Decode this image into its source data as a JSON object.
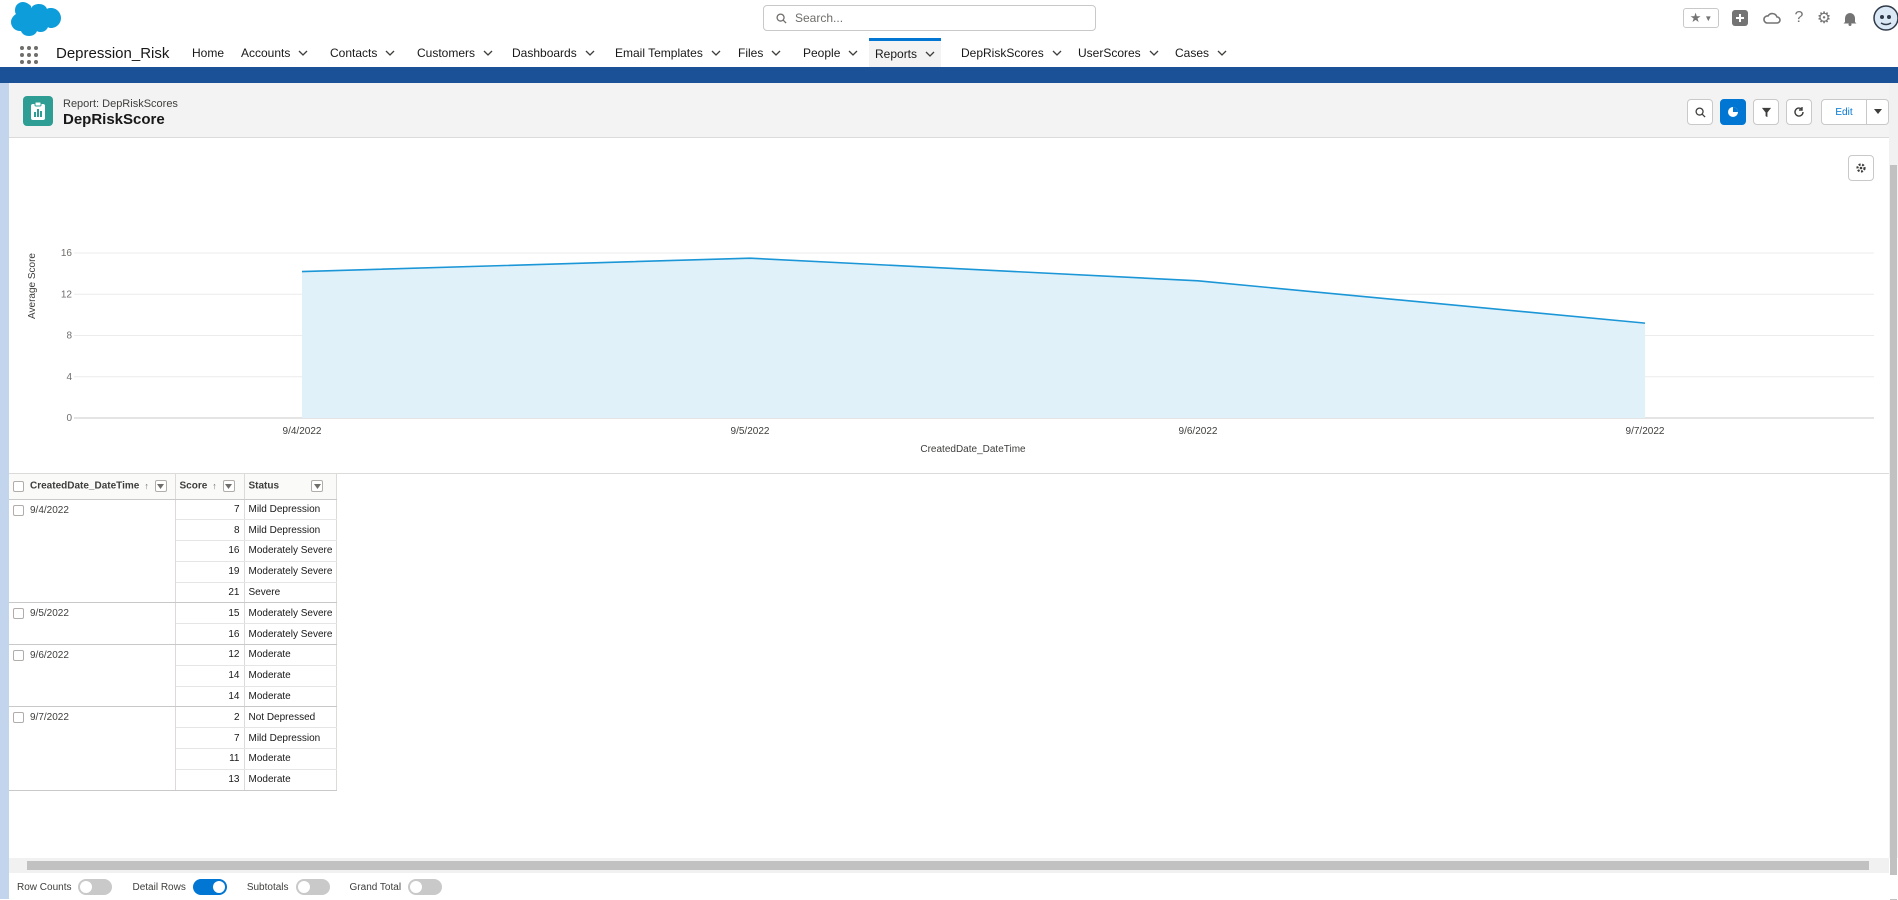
{
  "app": {
    "name": "Depression_Risk"
  },
  "search": {
    "placeholder": "Search..."
  },
  "nav": {
    "items": [
      {
        "label": "Home"
      },
      {
        "label": "Accounts"
      },
      {
        "label": "Contacts"
      },
      {
        "label": "Customers"
      },
      {
        "label": "Dashboards"
      },
      {
        "label": "Email Templates"
      },
      {
        "label": "Files"
      },
      {
        "label": "People"
      },
      {
        "label": "Reports",
        "active": true
      },
      {
        "label": "DepRiskScores"
      },
      {
        "label": "UserScores"
      },
      {
        "label": "Cases"
      }
    ]
  },
  "report": {
    "subtitle": "Report: DepRiskScores",
    "title": "DepRiskScore",
    "edit_label": "Edit"
  },
  "chart_data": {
    "type": "area",
    "categories": [
      "9/4/2022",
      "9/5/2022",
      "9/6/2022",
      "9/7/2022"
    ],
    "series": [
      {
        "name": "Average Score",
        "values": [
          14.2,
          15.5,
          13.3,
          9.2
        ]
      }
    ],
    "xlabel": "CreatedDate_DateTime",
    "ylabel": "Average Score",
    "ylim": [
      0,
      16
    ],
    "yticks": [
      "0",
      "4",
      "8",
      "12",
      "16"
    ],
    "grid": true,
    "colors": {
      "line": "#1b96d6",
      "fill": "#e1f1fa"
    }
  },
  "table": {
    "columns": [
      "CreatedDate_DateTime",
      "Score",
      "Status"
    ],
    "groups": [
      {
        "date": "9/4/2022",
        "rows": [
          {
            "score": "7",
            "status": "Mild Depression"
          },
          {
            "score": "8",
            "status": "Mild Depression"
          },
          {
            "score": "16",
            "status": "Moderately Severe"
          },
          {
            "score": "19",
            "status": "Moderately Severe"
          },
          {
            "score": "21",
            "status": "Severe"
          }
        ]
      },
      {
        "date": "9/5/2022",
        "rows": [
          {
            "score": "15",
            "status": "Moderately Severe"
          },
          {
            "score": "16",
            "status": "Moderately Severe"
          }
        ]
      },
      {
        "date": "9/6/2022",
        "rows": [
          {
            "score": "12",
            "status": "Moderate"
          },
          {
            "score": "14",
            "status": "Moderate"
          },
          {
            "score": "14",
            "status": "Moderate"
          }
        ]
      },
      {
        "date": "9/7/2022",
        "rows": [
          {
            "score": "2",
            "status": "Not Depressed"
          },
          {
            "score": "7",
            "status": "Mild Depression"
          },
          {
            "score": "11",
            "status": "Moderate"
          },
          {
            "score": "13",
            "status": "Moderate"
          }
        ]
      }
    ]
  },
  "footer": {
    "toggles": [
      {
        "label": "Row Counts",
        "on": false
      },
      {
        "label": "Detail Rows",
        "on": true
      },
      {
        "label": "Subtotals",
        "on": false
      },
      {
        "label": "Grand Total",
        "on": false
      }
    ]
  }
}
